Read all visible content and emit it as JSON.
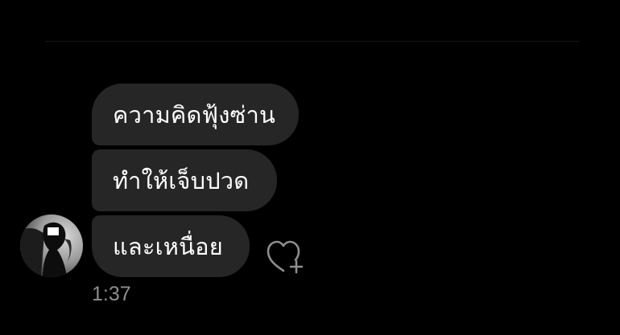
{
  "messages": [
    {
      "text": "ความคิดฟุ้งซ่าน"
    },
    {
      "text": "ทำให้เจ็บปวด"
    },
    {
      "text": "และเหนื่อย"
    }
  ],
  "timestamp": "1:37",
  "icons": {
    "react": "heart-plus-icon",
    "avatar": "avatar"
  },
  "colors": {
    "background": "#000000",
    "bubble": "#262626",
    "text": "#ffffff",
    "timestamp": "#8e8e8e"
  }
}
